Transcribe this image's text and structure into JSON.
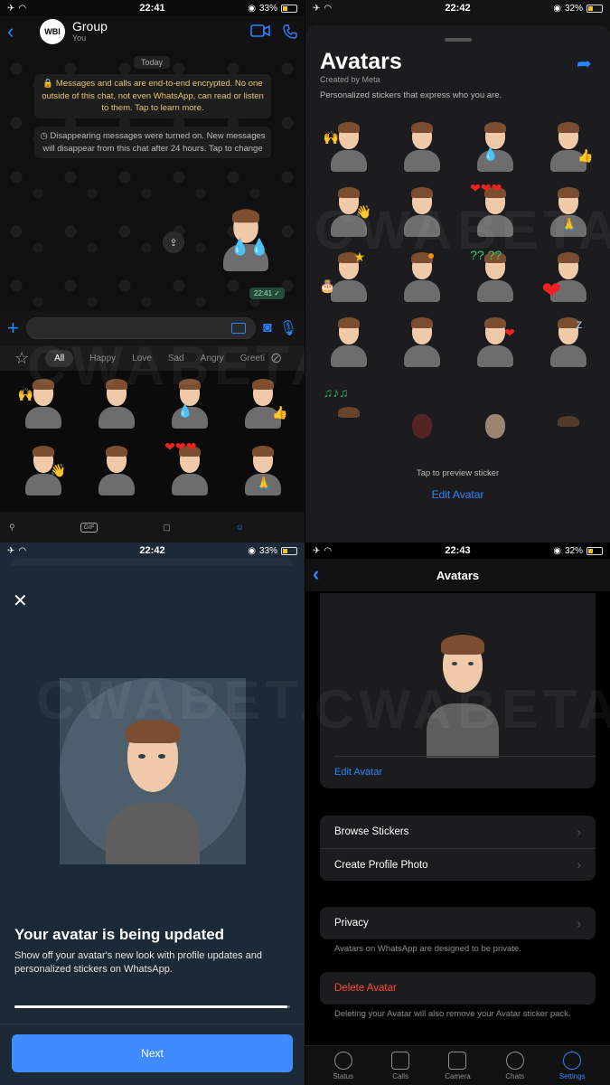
{
  "panel1": {
    "status": {
      "time": "22:41",
      "battery": "33%"
    },
    "header": {
      "group_initials": "WBI",
      "group_name": "Group",
      "subtitle": "You"
    },
    "chat": {
      "date_chip": "Today",
      "encryption_notice": "🔒 Messages and calls are end-to-end encrypted. No one outside of this chat, not even WhatsApp, can read or listen to them. Tap to learn more.",
      "disappearing_notice": "◷ Disappearing messages were turned on. New messages will disappear from this chat after 24 hours. Tap to change",
      "message_time": "22:41 ✓"
    },
    "composer": {
      "placeholder": ""
    },
    "categories": [
      "All",
      "Happy",
      "Love",
      "Sad",
      "Angry",
      "Greeti"
    ],
    "tray": {
      "gif_label": "GIF"
    }
  },
  "panel2": {
    "status": {
      "time": "22:42",
      "battery": "32%"
    },
    "title": "Avatars",
    "created_by": "Created by Meta",
    "description": "Personalized stickers that express who you are.",
    "preview_hint": "Tap to preview sticker",
    "edit_avatar": "Edit Avatar"
  },
  "panel3": {
    "status": {
      "time": "22:42",
      "battery": "33%"
    },
    "title": "Your avatar is being updated",
    "description": "Show off your avatar's new look with profile updates and personalized stickers on WhatsApp.",
    "progress": 0.99,
    "next_label": "Next"
  },
  "panel4": {
    "status": {
      "time": "22:43",
      "battery": "32%"
    },
    "title": "Avatars",
    "edit_avatar": "Edit Avatar",
    "browse_stickers": "Browse Stickers",
    "create_profile_photo": "Create Profile Photo",
    "privacy": "Privacy",
    "privacy_note": "Avatars on WhatsApp are designed to be private.",
    "delete_avatar": "Delete Avatar",
    "delete_note": "Deleting your Avatar will also remove your Avatar sticker pack.",
    "tabs": [
      "Status",
      "Calls",
      "Camera",
      "Chats",
      "Settings"
    ]
  },
  "watermark": "CWABETAINFO"
}
